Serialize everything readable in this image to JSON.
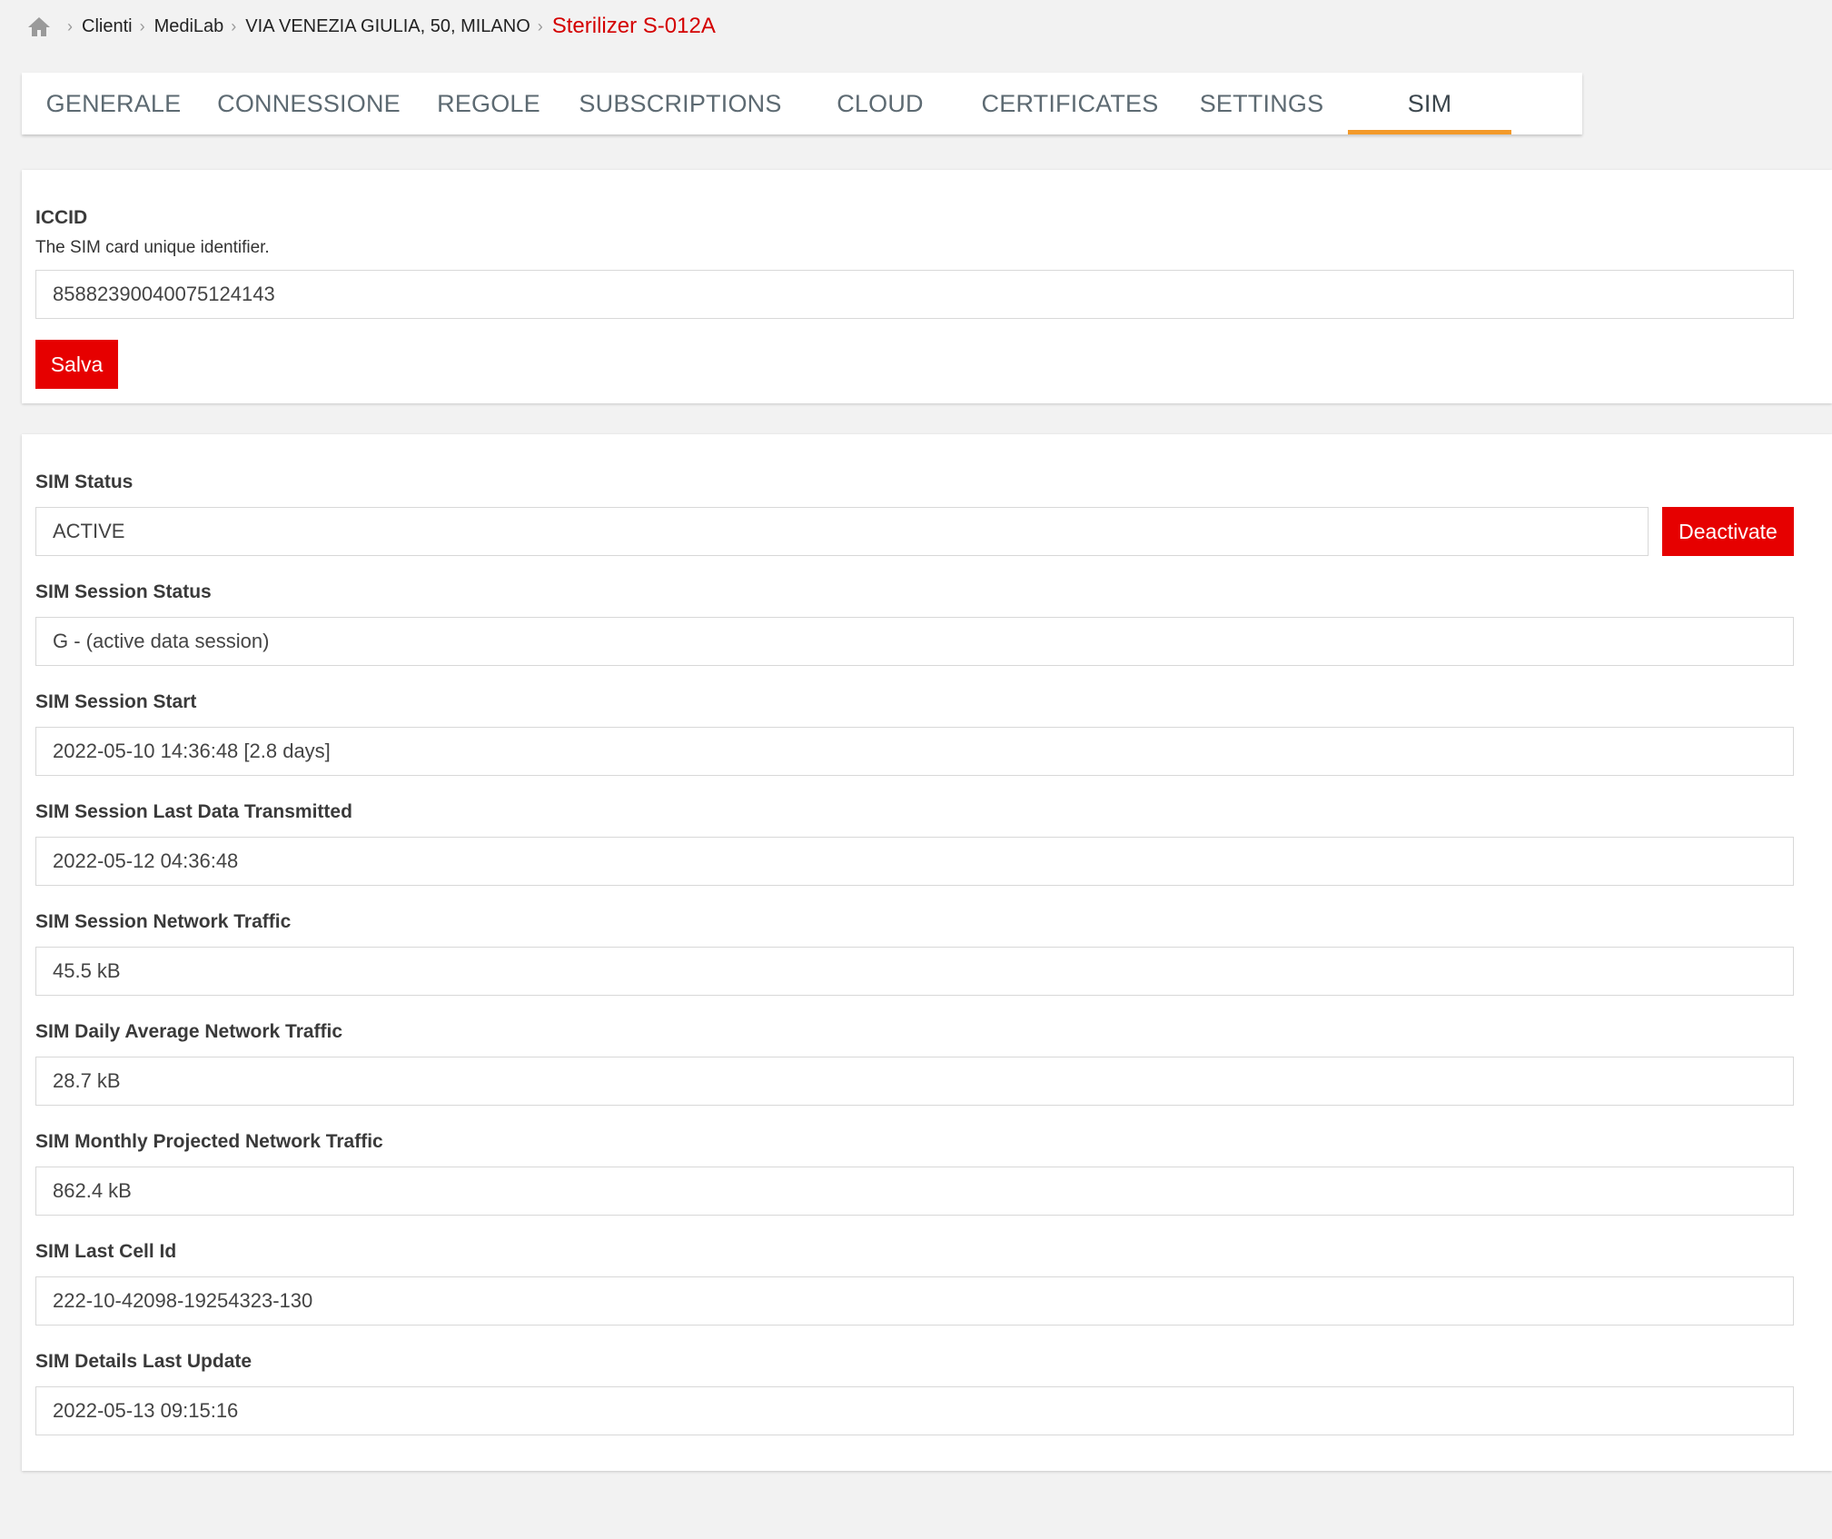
{
  "breadcrumb": {
    "items": [
      "Clienti",
      "MediLab",
      "VIA VENEZIA GIULIA, 50, MILANO"
    ],
    "current": "Sterilizer S-012A"
  },
  "tabs": [
    {
      "label": "GENERALE"
    },
    {
      "label": "CONNESSIONE"
    },
    {
      "label": "REGOLE"
    },
    {
      "label": "SUBSCRIPTIONS"
    },
    {
      "label": "CLOUD"
    },
    {
      "label": "CERTIFICATES"
    },
    {
      "label": "SETTINGS"
    },
    {
      "label": "SIM",
      "active": true
    }
  ],
  "iccid": {
    "label": "ICCID",
    "description": "The SIM card unique identifier.",
    "value": "85882390040075124143",
    "save_label": "Salva"
  },
  "sim": {
    "status_label": "SIM Status",
    "status_value": "ACTIVE",
    "deactivate_label": "Deactivate",
    "fields": [
      {
        "label": "SIM Session Status",
        "value": "G - (active data session)"
      },
      {
        "label": "SIM Session Start",
        "value": "2022-05-10 14:36:48 [2.8 days]"
      },
      {
        "label": "SIM Session Last Data Transmitted",
        "value": "2022-05-12 04:36:48"
      },
      {
        "label": "SIM Session Network Traffic",
        "value": "45.5 kB"
      },
      {
        "label": "SIM Daily Average Network Traffic",
        "value": "28.7 kB"
      },
      {
        "label": "SIM Monthly Projected Network Traffic",
        "value": "862.4 kB"
      },
      {
        "label": "SIM Last Cell Id",
        "value": "222-10-42098-19254323-130"
      },
      {
        "label": "SIM Details Last Update",
        "value": "2022-05-13 09:15:16"
      }
    ]
  },
  "colors": {
    "accent_red": "#e60000",
    "tab_underline": "#f39a2a",
    "breadcrumb_current": "#d40000"
  },
  "icons": {
    "home": "home-icon",
    "separator": "chevron-right-icon"
  }
}
